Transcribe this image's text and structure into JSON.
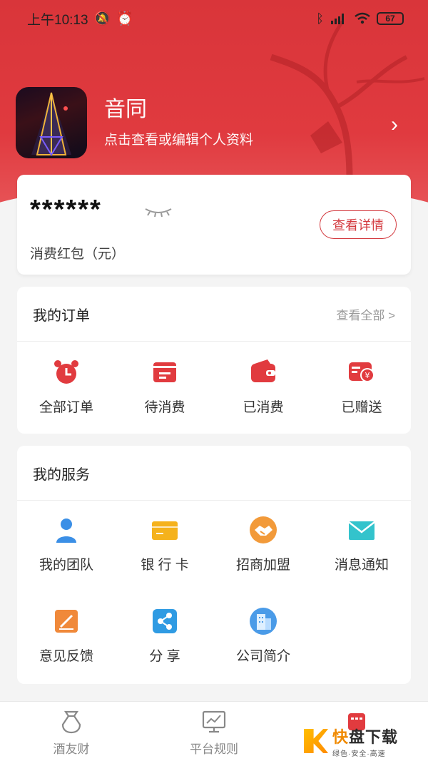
{
  "status_bar": {
    "time": "上午10:13",
    "battery": "67"
  },
  "profile": {
    "name": "音同",
    "subtitle": "点击查看或编辑个人资料"
  },
  "balance": {
    "value": "******",
    "label": "消费红包（元）",
    "detail_button": "查看详情"
  },
  "orders": {
    "title": "我的订单",
    "view_all": "查看全部 >",
    "items": [
      {
        "label": "全部订单",
        "icon": "alarm-clock-icon"
      },
      {
        "label": "待消费",
        "icon": "card-icon"
      },
      {
        "label": "已消费",
        "icon": "wallet-icon"
      },
      {
        "label": "已赠送",
        "icon": "yen-card-icon"
      }
    ]
  },
  "services": {
    "title": "我的服务",
    "items": [
      {
        "label": "我的团队",
        "icon": "user-icon"
      },
      {
        "label": "银 行 卡",
        "icon": "bank-card-icon"
      },
      {
        "label": "招商加盟",
        "icon": "handshake-icon"
      },
      {
        "label": "消息通知",
        "icon": "mail-icon"
      },
      {
        "label": "意见反馈",
        "icon": "edit-icon"
      },
      {
        "label": "分 享",
        "icon": "share-icon"
      },
      {
        "label": "公司简介",
        "icon": "building-icon"
      }
    ]
  },
  "bottom_nav": {
    "items": [
      {
        "label": "酒友财",
        "icon": "wine-jar-icon"
      },
      {
        "label": "平台规则",
        "icon": "monitor-chart-icon"
      }
    ]
  },
  "watermark": {
    "main_a": "快",
    "main_b": "盘下载",
    "sub": "绿色·安全·高速"
  },
  "colors": {
    "primary": "#d9353a",
    "blue": "#3b8fe6",
    "yellow": "#f5b21c",
    "orange": "#f29a3a",
    "cyan": "#33c3cc"
  }
}
